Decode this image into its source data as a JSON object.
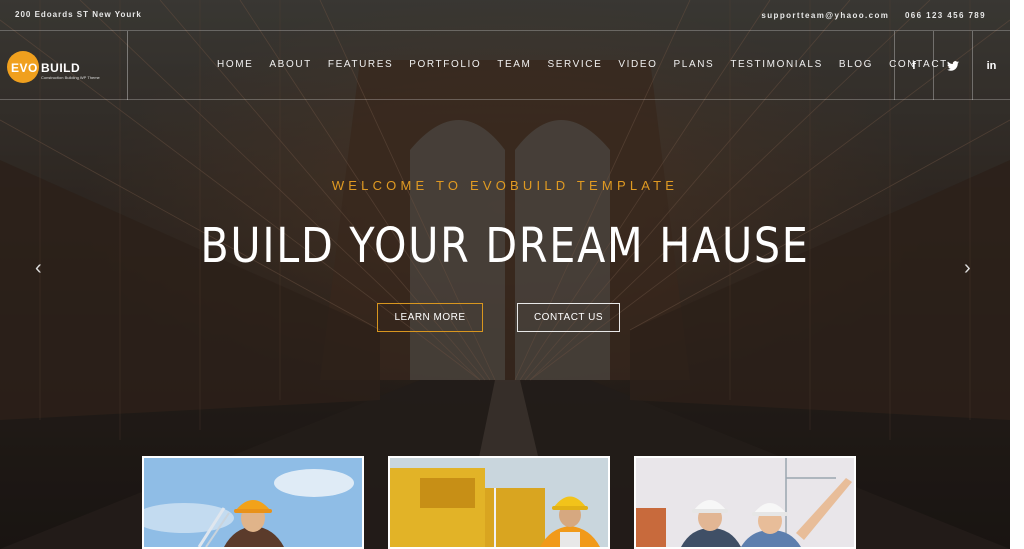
{
  "topbar": {
    "address": "200 Edoards ST New Yourk",
    "email": "supportteam@yhaoo.com",
    "phone": "066 123 456 789"
  },
  "logo": {
    "part1": "EVO",
    "part2": "BUILD",
    "tagline": "Construction Building WP Theme"
  },
  "nav": {
    "items": [
      "HOME",
      "ABOUT",
      "FEATURES",
      "PORTFOLIO",
      "TEAM",
      "SERVICE",
      "VIDEO",
      "PLANS",
      "TESTIMONIALS",
      "BLOG",
      "CONTACT"
    ]
  },
  "socials": {
    "facebook": "f",
    "twitter": "🐦",
    "linkedin": "in"
  },
  "hero": {
    "welcome": "WELCOME TO EVOBUILD TEMPLATE",
    "headline": "BUILD YOUR DREAM HAUSE",
    "learn_more": "LEARN MORE",
    "contact_us": "CONTACT US",
    "prev_arrow": "‹",
    "next_arrow": "›"
  },
  "colors": {
    "accent": "#e09a22",
    "logo_orange": "#f0a01e"
  },
  "cards": [
    {
      "icon": "worker-orange-helmet-photo"
    },
    {
      "icon": "worker-yellow-helmet-machinery-photo"
    },
    {
      "icon": "two-engineers-white-helmets-photo"
    }
  ]
}
